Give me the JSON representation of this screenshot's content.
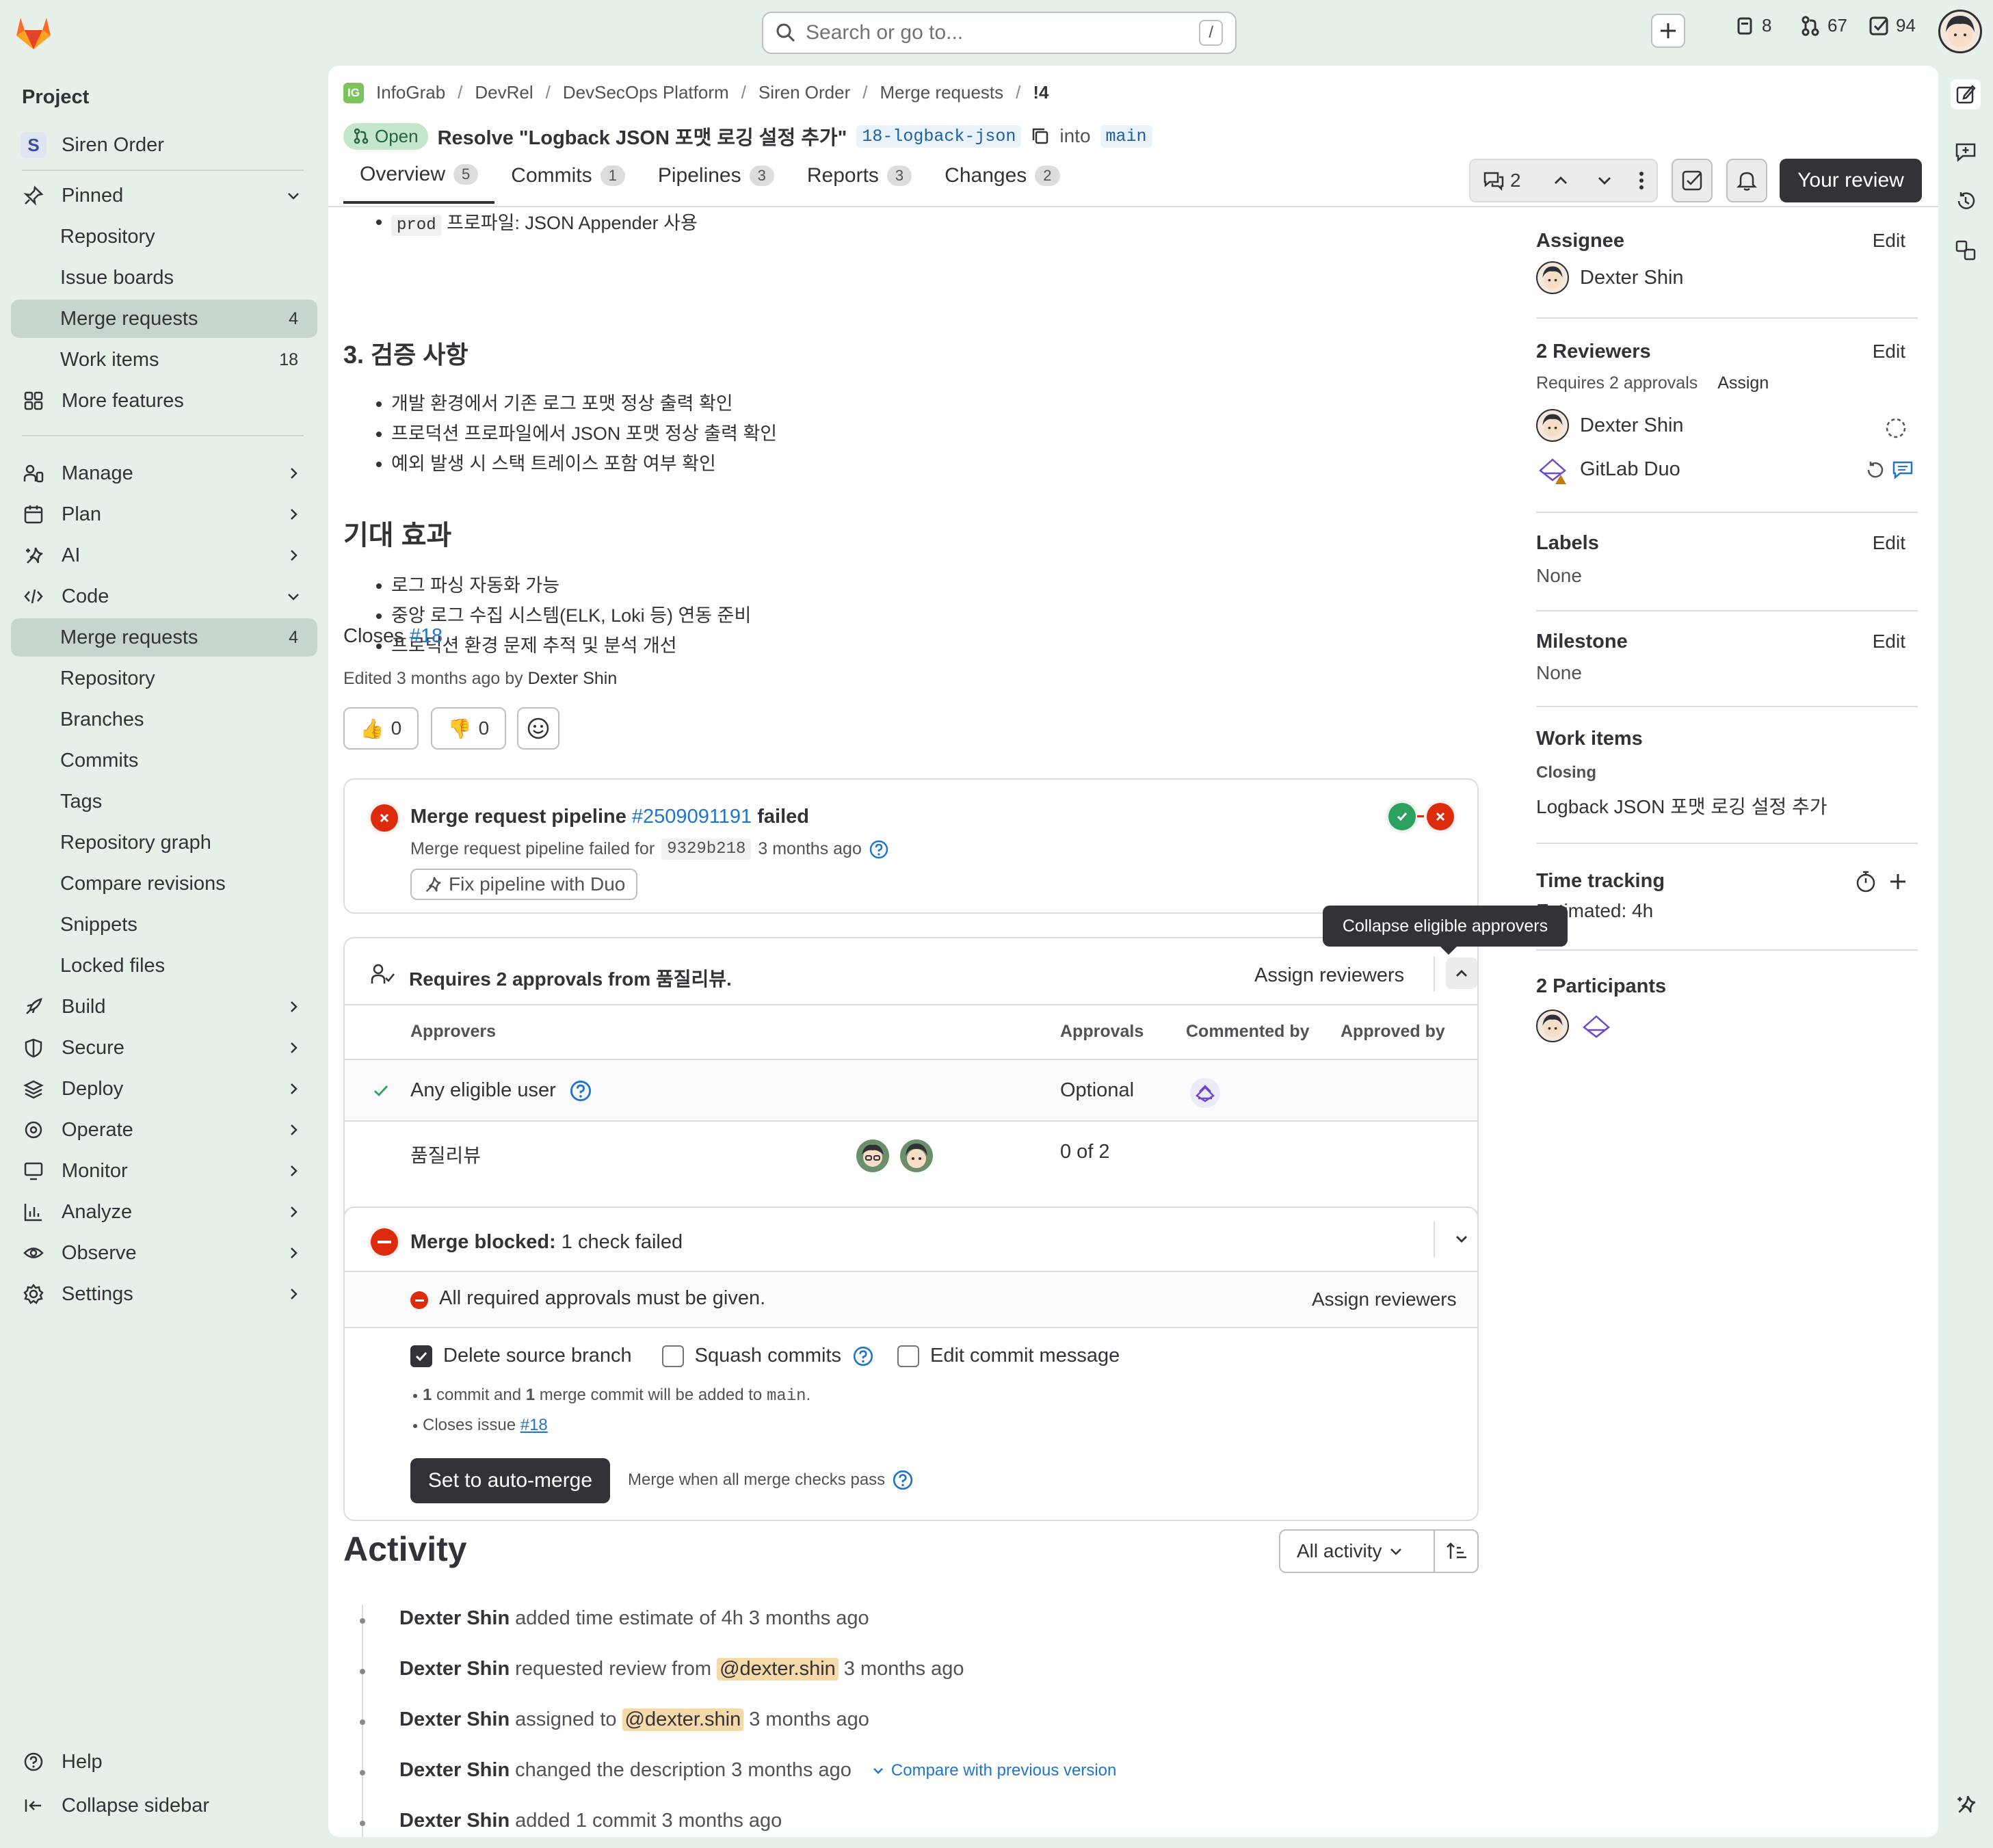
{
  "topbar": {
    "search_placeholder": "Search or go to...",
    "search_shortcut": "/",
    "issues_count": "8",
    "mrs_count": "67",
    "todos_count": "94"
  },
  "sidebar": {
    "title": "Project",
    "project_initial": "S",
    "project_name": "Siren Order",
    "pinned": "Pinned",
    "pinned_items": [
      {
        "label": "Repository"
      },
      {
        "label": "Issue boards"
      },
      {
        "label": "Merge requests",
        "count": "4"
      },
      {
        "label": "Work items",
        "count": "18"
      }
    ],
    "more_features": "More features",
    "sections": {
      "manage": "Manage",
      "plan": "Plan",
      "ai": "AI",
      "code": "Code",
      "build": "Build",
      "secure": "Secure",
      "deploy": "Deploy",
      "operate": "Operate",
      "monitor": "Monitor",
      "analyze": "Analyze",
      "observe": "Observe",
      "settings": "Settings"
    },
    "code_items": [
      {
        "label": "Merge requests",
        "count": "4"
      },
      {
        "label": "Repository"
      },
      {
        "label": "Branches"
      },
      {
        "label": "Commits"
      },
      {
        "label": "Tags"
      },
      {
        "label": "Repository graph"
      },
      {
        "label": "Compare revisions"
      },
      {
        "label": "Snippets"
      },
      {
        "label": "Locked files"
      }
    ],
    "help": "Help",
    "collapse": "Collapse sidebar"
  },
  "breadcrumb": [
    "InfoGrab",
    "DevRel",
    "DevSecOps Platform",
    "Siren Order",
    "Merge requests",
    "!4"
  ],
  "mr": {
    "status": "Open",
    "title": "Resolve \"Logback JSON 포맷 로깅 설정 추가\"",
    "source_branch": "18-logback-json",
    "into": "into",
    "target_branch": "main"
  },
  "tabs": [
    {
      "label": "Overview",
      "count": "5"
    },
    {
      "label": "Commits",
      "count": "1"
    },
    {
      "label": "Pipelines",
      "count": "3"
    },
    {
      "label": "Reports",
      "count": "3"
    },
    {
      "label": "Changes",
      "count": "2"
    }
  ],
  "header_actions": {
    "comments_count": "2",
    "review_button": "Your review"
  },
  "description": {
    "prod_code": "prod",
    "prod_text": "프로파일: JSON Appender 사용",
    "section3_title": "3. 검증 사항",
    "section3_items": [
      "개발 환경에서 기존 로그 포맷 정상 출력 확인",
      "프로덕션 프로파일에서 JSON 포맷 정상 출력 확인",
      "예외 발생 시 스택 트레이스 포함 여부 확인"
    ],
    "effects_title": "기대 효과",
    "effects_items": [
      "로그 파싱 자동화 가능",
      "중앙 로그 수집 시스템(ELK, Loki 등) 연동 준비",
      "프로덕션 환경 문제 추적 및 분석 개선"
    ],
    "closes_label": "Closes",
    "closes_ref": "#18",
    "edited_text": "Edited 3 months ago by",
    "edited_by": "Dexter Shin"
  },
  "reactions": {
    "thumbsup": "👍",
    "thumbsup_count": "0",
    "thumbsdown": "👎",
    "thumbsdown_count": "0"
  },
  "pipeline": {
    "title_prefix": "Merge request pipeline",
    "pipeline_id": "#2509091191",
    "status": "failed",
    "sub_text": "Merge request pipeline failed for",
    "commit": "9329b218",
    "time": "3 months ago",
    "fix_button": "Fix pipeline with Duo"
  },
  "approvals": {
    "title": "Requires 2 approvals from 품질리뷰.",
    "assign_reviewers": "Assign reviewers",
    "tooltip": "Collapse eligible approvers",
    "columns": [
      "Approvers",
      "Approvals",
      "Commented by",
      "Approved by"
    ],
    "rows": [
      {
        "name": "Any eligible user",
        "approvals": "Optional"
      },
      {
        "name": "품질리뷰",
        "approvals": "0 of 2"
      }
    ]
  },
  "merge": {
    "blocked_label": "Merge blocked:",
    "blocked_detail": "1 check failed",
    "check_text": "All required approvals must be given.",
    "assign_reviewers": "Assign reviewers",
    "delete_branch": "Delete source branch",
    "squash": "Squash commits",
    "edit_message": "Edit commit message",
    "info1_a": "1",
    "info1_b": "commit and",
    "info1_c": "1",
    "info1_d": "merge commit will be added to",
    "info1_branch": "main",
    "info2_text": "Closes issue",
    "info2_ref": "#18",
    "auto_merge_button": "Set to auto-merge",
    "auto_merge_hint": "Merge when all merge checks pass"
  },
  "activity": {
    "title": "Activity",
    "filter": "All activity",
    "items": [
      {
        "user": "Dexter Shin",
        "text": "added time estimate of 4h 3 months ago"
      },
      {
        "user": "Dexter Shin",
        "text": "requested review from",
        "mention": "@dexter.shin",
        "time": "3 months ago"
      },
      {
        "user": "Dexter Shin",
        "text": "assigned to",
        "mention": "@dexter.shin",
        "time": "3 months ago"
      },
      {
        "user": "Dexter Shin",
        "text": "changed the description 3 months ago",
        "link": "Compare with previous version"
      },
      {
        "user": "Dexter Shin",
        "text": "added 1 commit 3 months ago"
      }
    ]
  },
  "right_sidebar": {
    "assignee_title": "Assignee",
    "edit": "Edit",
    "assignee_name": "Dexter Shin",
    "reviewers_title": "2 Reviewers",
    "requires": "Requires 2 approvals",
    "assign": "Assign",
    "reviewers": [
      "Dexter Shin",
      "GitLab Duo"
    ],
    "labels_title": "Labels",
    "labels_value": "None",
    "milestone_title": "Milestone",
    "milestone_value": "None",
    "work_items_title": "Work items",
    "closing_label": "Closing",
    "closing_item": "Logback JSON 포맷 로깅 설정 추가",
    "time_tracking_title": "Time tracking",
    "estimated": "Estimated: 4h",
    "participants_title": "2 Participants"
  }
}
